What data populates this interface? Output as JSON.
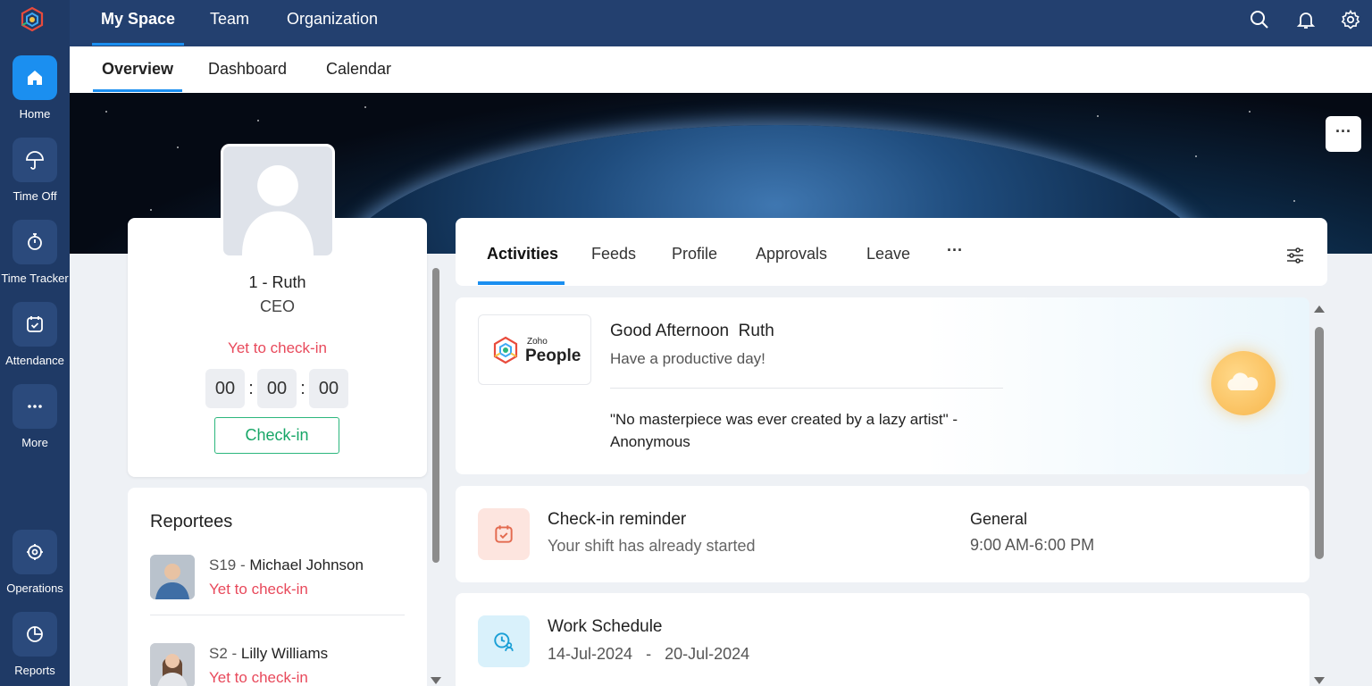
{
  "top_nav": {
    "items": [
      "My Space",
      "Team",
      "Organization"
    ],
    "active": "My Space"
  },
  "sub_tabs": {
    "items": [
      "Overview",
      "Dashboard",
      "Calendar"
    ],
    "active": "Overview"
  },
  "sidebar": {
    "items": [
      {
        "label": "Home",
        "icon": "home-icon",
        "active": true
      },
      {
        "label": "Time Off",
        "icon": "umbrella-icon"
      },
      {
        "label": "Time Tracker",
        "icon": "stopwatch-icon"
      },
      {
        "label": "Attendance",
        "icon": "calendar-check-icon"
      },
      {
        "label": "More",
        "icon": "more-dots-icon"
      },
      {
        "label": "Operations",
        "icon": "operations-icon"
      },
      {
        "label": "Reports",
        "icon": "pie-chart-icon"
      }
    ]
  },
  "profile": {
    "name": "1 - Ruth",
    "role": "CEO",
    "status": "Yet to check-in",
    "timer": {
      "hours": "00",
      "minutes": "00",
      "seconds": "00"
    },
    "checkin_label": "Check-in"
  },
  "reportees": {
    "title": "Reportees",
    "items": [
      {
        "id": "S19",
        "name": "Michael Johnson",
        "status": "Yet to check-in"
      },
      {
        "id": "S2",
        "name": "Lilly Williams",
        "status": "Yet to check-in"
      }
    ]
  },
  "activity_tabs": {
    "items": [
      "Activities",
      "Feeds",
      "Profile",
      "Approvals",
      "Leave"
    ],
    "active": "Activities",
    "more": "···"
  },
  "greeting": {
    "logo_small": "Zoho",
    "logo_big": "People",
    "salutation": "Good Afternoon",
    "name": "Ruth",
    "subtitle": "Have a productive day!",
    "quote": "\"No masterpiece was ever created by a lazy artist\" - Anonymous"
  },
  "checkin_reminder": {
    "title": "Check-in reminder",
    "subtitle": "Your shift has already started",
    "shift_name": "General",
    "shift_time": "9:00 AM-6:00 PM"
  },
  "work_schedule": {
    "title": "Work Schedule",
    "from": "14-Jul-2024",
    "separator": "-",
    "to": "20-Jul-2024"
  },
  "banner": {
    "more": "···"
  },
  "colors": {
    "rail": "#1f3a66",
    "topbar": "#23406f",
    "accent": "#1b8ff0",
    "alert": "#e8495b",
    "success": "#17a667"
  }
}
